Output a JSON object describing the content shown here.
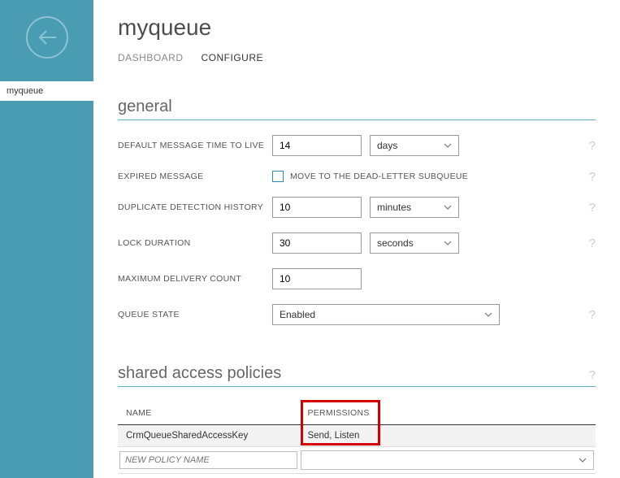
{
  "sidebar": {
    "active_item": "myqueue"
  },
  "page": {
    "title": "myqueue"
  },
  "tabs": {
    "dashboard": "DASHBOARD",
    "configure": "CONFIGURE"
  },
  "sections": {
    "general": {
      "title": "general",
      "fields": {
        "ttl_label": "DEFAULT MESSAGE TIME TO LIVE",
        "ttl_value": "14",
        "ttl_unit": "days",
        "expired_label": "EXPIRED MESSAGE",
        "expired_checkbox_label": "MOVE TO THE DEAD-LETTER SUBQUEUE",
        "dup_label": "DUPLICATE DETECTION HISTORY",
        "dup_value": "10",
        "dup_unit": "minutes",
        "lock_label": "LOCK DURATION",
        "lock_value": "30",
        "lock_unit": "seconds",
        "maxdel_label": "MAXIMUM DELIVERY COUNT",
        "maxdel_value": "10",
        "qstate_label": "QUEUE STATE",
        "qstate_value": "Enabled"
      }
    },
    "policies": {
      "title": "shared access policies",
      "columns": {
        "name": "NAME",
        "permissions": "PERMISSIONS"
      },
      "rows": [
        {
          "name": "CrmQueueSharedAccessKey",
          "permissions": "Send, Listen"
        }
      ],
      "new_placeholder": "NEW POLICY NAME"
    }
  }
}
